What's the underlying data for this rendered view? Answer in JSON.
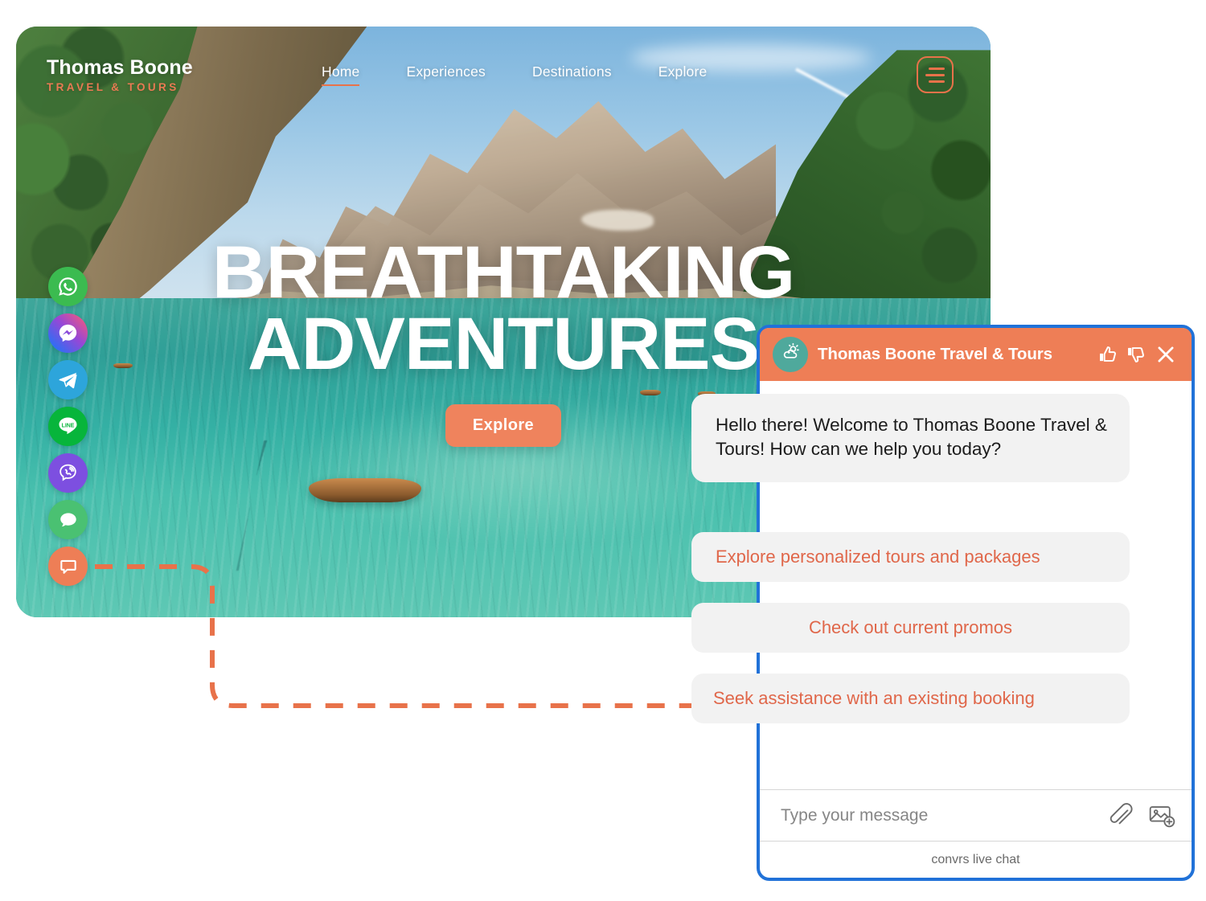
{
  "site": {
    "logo": {
      "name": "Thomas Boone",
      "tagline": "TRAVEL & TOURS"
    },
    "nav": [
      {
        "label": "Home",
        "active": true
      },
      {
        "label": "Experiences",
        "active": false
      },
      {
        "label": "Destinations",
        "active": false
      },
      {
        "label": "Explore",
        "active": false
      }
    ],
    "menu_icon": "hamburger-menu-icon",
    "hero": {
      "line1": "BREATHTAKING",
      "line2": "ADVENTURES",
      "cta_label": "Explore"
    }
  },
  "social_rail": [
    {
      "name": "whatsapp",
      "icon": "whatsapp-icon",
      "color": "#3bbb50"
    },
    {
      "name": "messenger",
      "icon": "messenger-icon",
      "color": "#9747d6"
    },
    {
      "name": "telegram",
      "icon": "telegram-icon",
      "color": "#2da5db"
    },
    {
      "name": "line",
      "icon": "line-icon",
      "color": "#07b53b",
      "label": "LINE"
    },
    {
      "name": "viber",
      "icon": "viber-icon",
      "color": "#7d4fe0"
    },
    {
      "name": "sms",
      "icon": "sms-bubble-icon",
      "color": "#4ac172"
    },
    {
      "name": "live-chat",
      "icon": "chat-bubble-icon",
      "color": "#ee7e56"
    }
  ],
  "chat": {
    "header": {
      "title": "Thomas Boone Travel & Tours",
      "avatar_icon": "sun-cloud-icon",
      "actions": [
        {
          "name": "thumbs-up",
          "icon": "thumbs-up-icon"
        },
        {
          "name": "thumbs-down",
          "icon": "thumbs-down-icon"
        },
        {
          "name": "close",
          "icon": "close-icon"
        }
      ]
    },
    "messages": [
      {
        "from": "bot",
        "text": "Hello there! Welcome to Thomas Boone Travel & Tours! How can we help you today?"
      }
    ],
    "quick_replies": [
      "Explore personalized tours and packages",
      "Check out current promos",
      "Seek assistance with an existing booking"
    ],
    "input": {
      "placeholder": "Type your message",
      "value": "",
      "attach_icon": "paperclip-icon",
      "image_icon": "image-add-icon"
    },
    "footer": "convrs live chat"
  },
  "colors": {
    "brand_orange": "#ee7e56",
    "quick_reply_text": "#e0674a",
    "chat_border_blue": "#2172d8",
    "avatar_teal": "#4fa99c"
  }
}
